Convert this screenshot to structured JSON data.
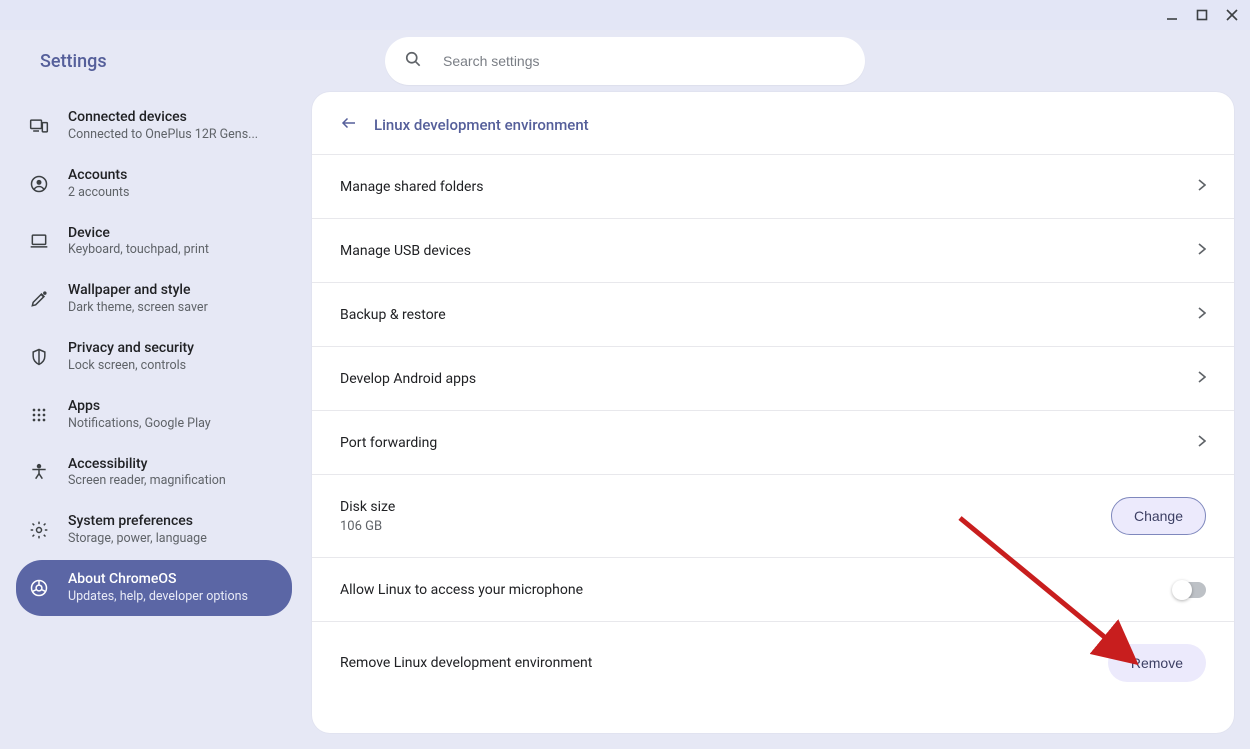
{
  "app": {
    "title": "Settings"
  },
  "search": {
    "placeholder": "Search settings"
  },
  "sidebar": {
    "items": [
      {
        "title": "Connected devices",
        "sub": "Connected to OnePlus 12R Gens..."
      },
      {
        "title": "Accounts",
        "sub": "2 accounts"
      },
      {
        "title": "Device",
        "sub": "Keyboard, touchpad, print"
      },
      {
        "title": "Wallpaper and style",
        "sub": "Dark theme, screen saver"
      },
      {
        "title": "Privacy and security",
        "sub": "Lock screen, controls"
      },
      {
        "title": "Apps",
        "sub": "Notifications, Google Play"
      },
      {
        "title": "Accessibility",
        "sub": "Screen reader, magnification"
      },
      {
        "title": "System preferences",
        "sub": "Storage, power, language"
      },
      {
        "title": "About ChromeOS",
        "sub": "Updates, help, developer options"
      }
    ],
    "active_index": 8
  },
  "page": {
    "title": "Linux development environment",
    "rows": {
      "shared_folders": "Manage shared folders",
      "usb_devices": "Manage USB devices",
      "backup": "Backup & restore",
      "android": "Develop Android apps",
      "port_fwd": "Port forwarding",
      "disk_title": "Disk size",
      "disk_value": "106 GB",
      "disk_button": "Change",
      "mic": "Allow Linux to access your microphone",
      "remove_title": "Remove Linux development environment",
      "remove_button": "Remove"
    },
    "mic_enabled": false
  }
}
